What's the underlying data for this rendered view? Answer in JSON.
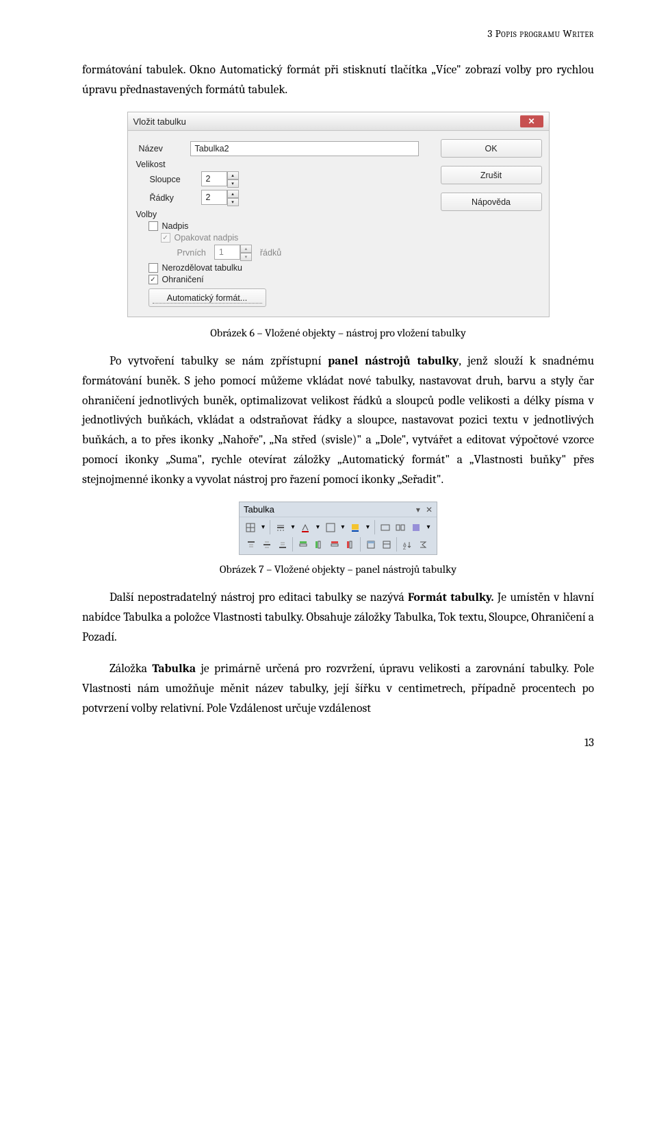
{
  "header": "3 Popis programu Writer",
  "p1": "formátování tabulek. Okno Automatický formát při stisknutí tlačítka „Více\" zobrazí volby pro rychlou úpravu přednastavených formátů tabulek.",
  "dialog": {
    "title": "Vložit tabulku",
    "name_label": "Název",
    "name_value": "Tabulka2",
    "size_label": "Velikost",
    "cols_label": "Sloupce",
    "cols_value": "2",
    "rows_label": "Řádky",
    "rows_value": "2",
    "opts_label": "Volby",
    "opt_heading": "Nadpis",
    "opt_repeat": "Opakovat nadpis",
    "first_label": "Prvních",
    "first_value": "1",
    "first_suffix": "řádků",
    "opt_nosplit": "Nerozdělovat tabulku",
    "opt_border": "Ohraničení",
    "autofmt_btn": "Automatický formát...",
    "ok_btn": "OK",
    "cancel_btn": "Zrušit",
    "help_btn": "Nápověda"
  },
  "caption1": "Obrázek 6 – Vložené objekty – nástroj pro vložení tabulky",
  "p2a": "Po vytvoření tabulky se nám zpřístupní ",
  "p2b": "panel nástrojů tabulky",
  "p2c": ", jenž slouží k snadnému formátování buněk. S jeho pomocí můžeme vkládat nové tabulky, nastavovat druh, barvu a styly čar ohraničení jednotlivých buněk, optimalizovat velikost řádků a sloupců podle velikosti a délky písma v jednotlivých buňkách, vkládat a odstraňovat řádky a sloupce, nastavovat pozici textu v jednotlivých buňkách, a to přes ikonky „Nahoře\", „Na střed (svisle)\" a „Dole\", vytvářet a editovat výpočtové vzorce pomocí ikonky „Suma\", rychle otevírat záložky „Automatický formát\" a „Vlastnosti buňky\" přes stejnojmenné ikonky a vyvolat nástroj pro řazení pomocí ikonky „Seřadit\".",
  "toolbar": {
    "title": "Tabulka"
  },
  "caption2": "Obrázek 7 – Vložené objekty – panel nástrojů tabulky",
  "p3a": "Další nepostradatelný nástroj pro editaci tabulky se nazývá ",
  "p3b": "Formát tabulky.",
  "p3c": " Je umístěn v hlavní nabídce Tabulka a položce Vlastnosti tabulky. Obsahuje záložky Tabulka, Tok textu, Sloupce, Ohraničení a Pozadí.",
  "p4a": "Záložka ",
  "p4b": "Tabulka",
  "p4c": " je primárně určená pro rozvržení, úpravu velikosti a zarovnání tabulky. Pole Vlastnosti nám umožňuje měnit název tabulky, její šířku v centimetrech, případně procentech po potvrzení volby relativní. Pole Vzdálenost určuje vzdálenost",
  "page_number": "13"
}
